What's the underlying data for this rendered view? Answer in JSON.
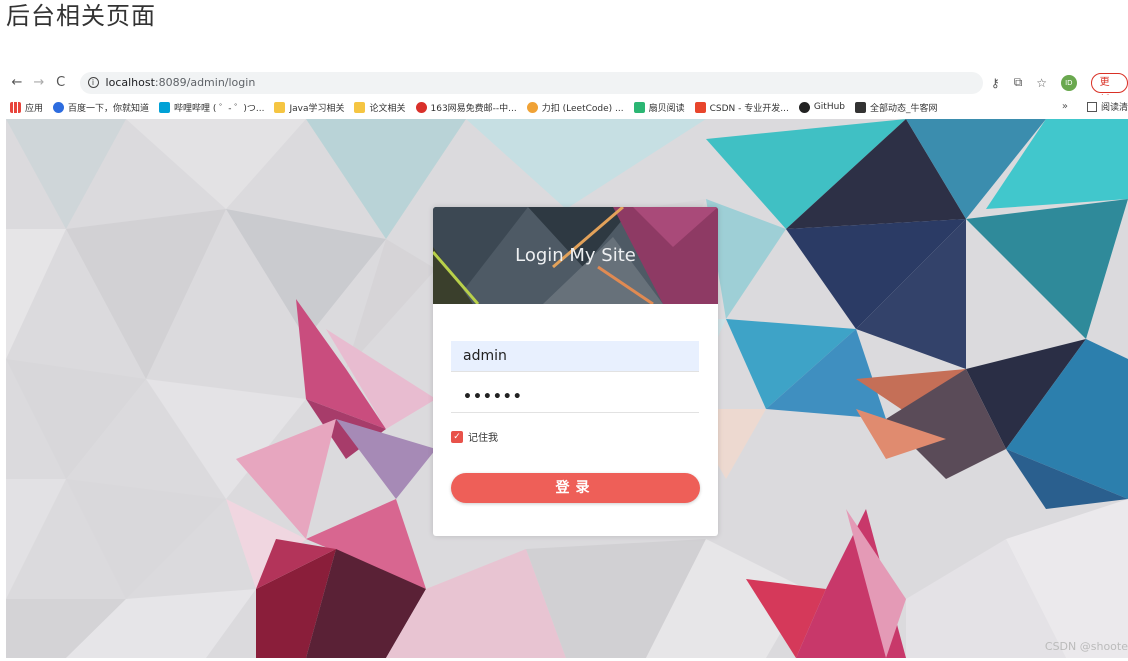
{
  "page_heading": "后台相关页面",
  "browser": {
    "nav": {
      "back": "←",
      "forward": "→",
      "reload": "C"
    },
    "url_host": "localhost",
    "url_path": ":8089/admin/login",
    "avatar_text": "ID",
    "update_label": "更新"
  },
  "bookmarks": {
    "items": [
      {
        "label": "应用",
        "color": "#e8453c"
      },
      {
        "label": "百度一下，你就知道",
        "color": "#2d6cdf"
      },
      {
        "label": "哔哩哔哩 ( ゜- ゜)つ...",
        "color": "#00a1d6"
      },
      {
        "label": "Java学习相关",
        "color": "#f5c542"
      },
      {
        "label": "论文相关",
        "color": "#f5c542"
      },
      {
        "label": "163网易免费邮--中...",
        "color": "#d9302a"
      },
      {
        "label": "力扣 (LeetCode) ...",
        "color": "#f0a236"
      },
      {
        "label": "扇贝阅读",
        "color": "#2bb673"
      },
      {
        "label": "CSDN - 专业开发...",
        "color": "#e8452c"
      },
      {
        "label": "GitHub",
        "color": "#222222"
      },
      {
        "label": "全部动态_牛客网",
        "color": "#333333"
      }
    ],
    "more": "»",
    "reading_list": "阅读清"
  },
  "login": {
    "title": "Login My Site",
    "username_value": "admin",
    "password_value": "••••••",
    "remember_label": "记住我",
    "submit_label": "登录"
  },
  "watermark": "CSDN @shoote",
  "colors": {
    "accent": "#ee5f58",
    "autofill": "#e8f0fe",
    "update": "#d93025"
  }
}
